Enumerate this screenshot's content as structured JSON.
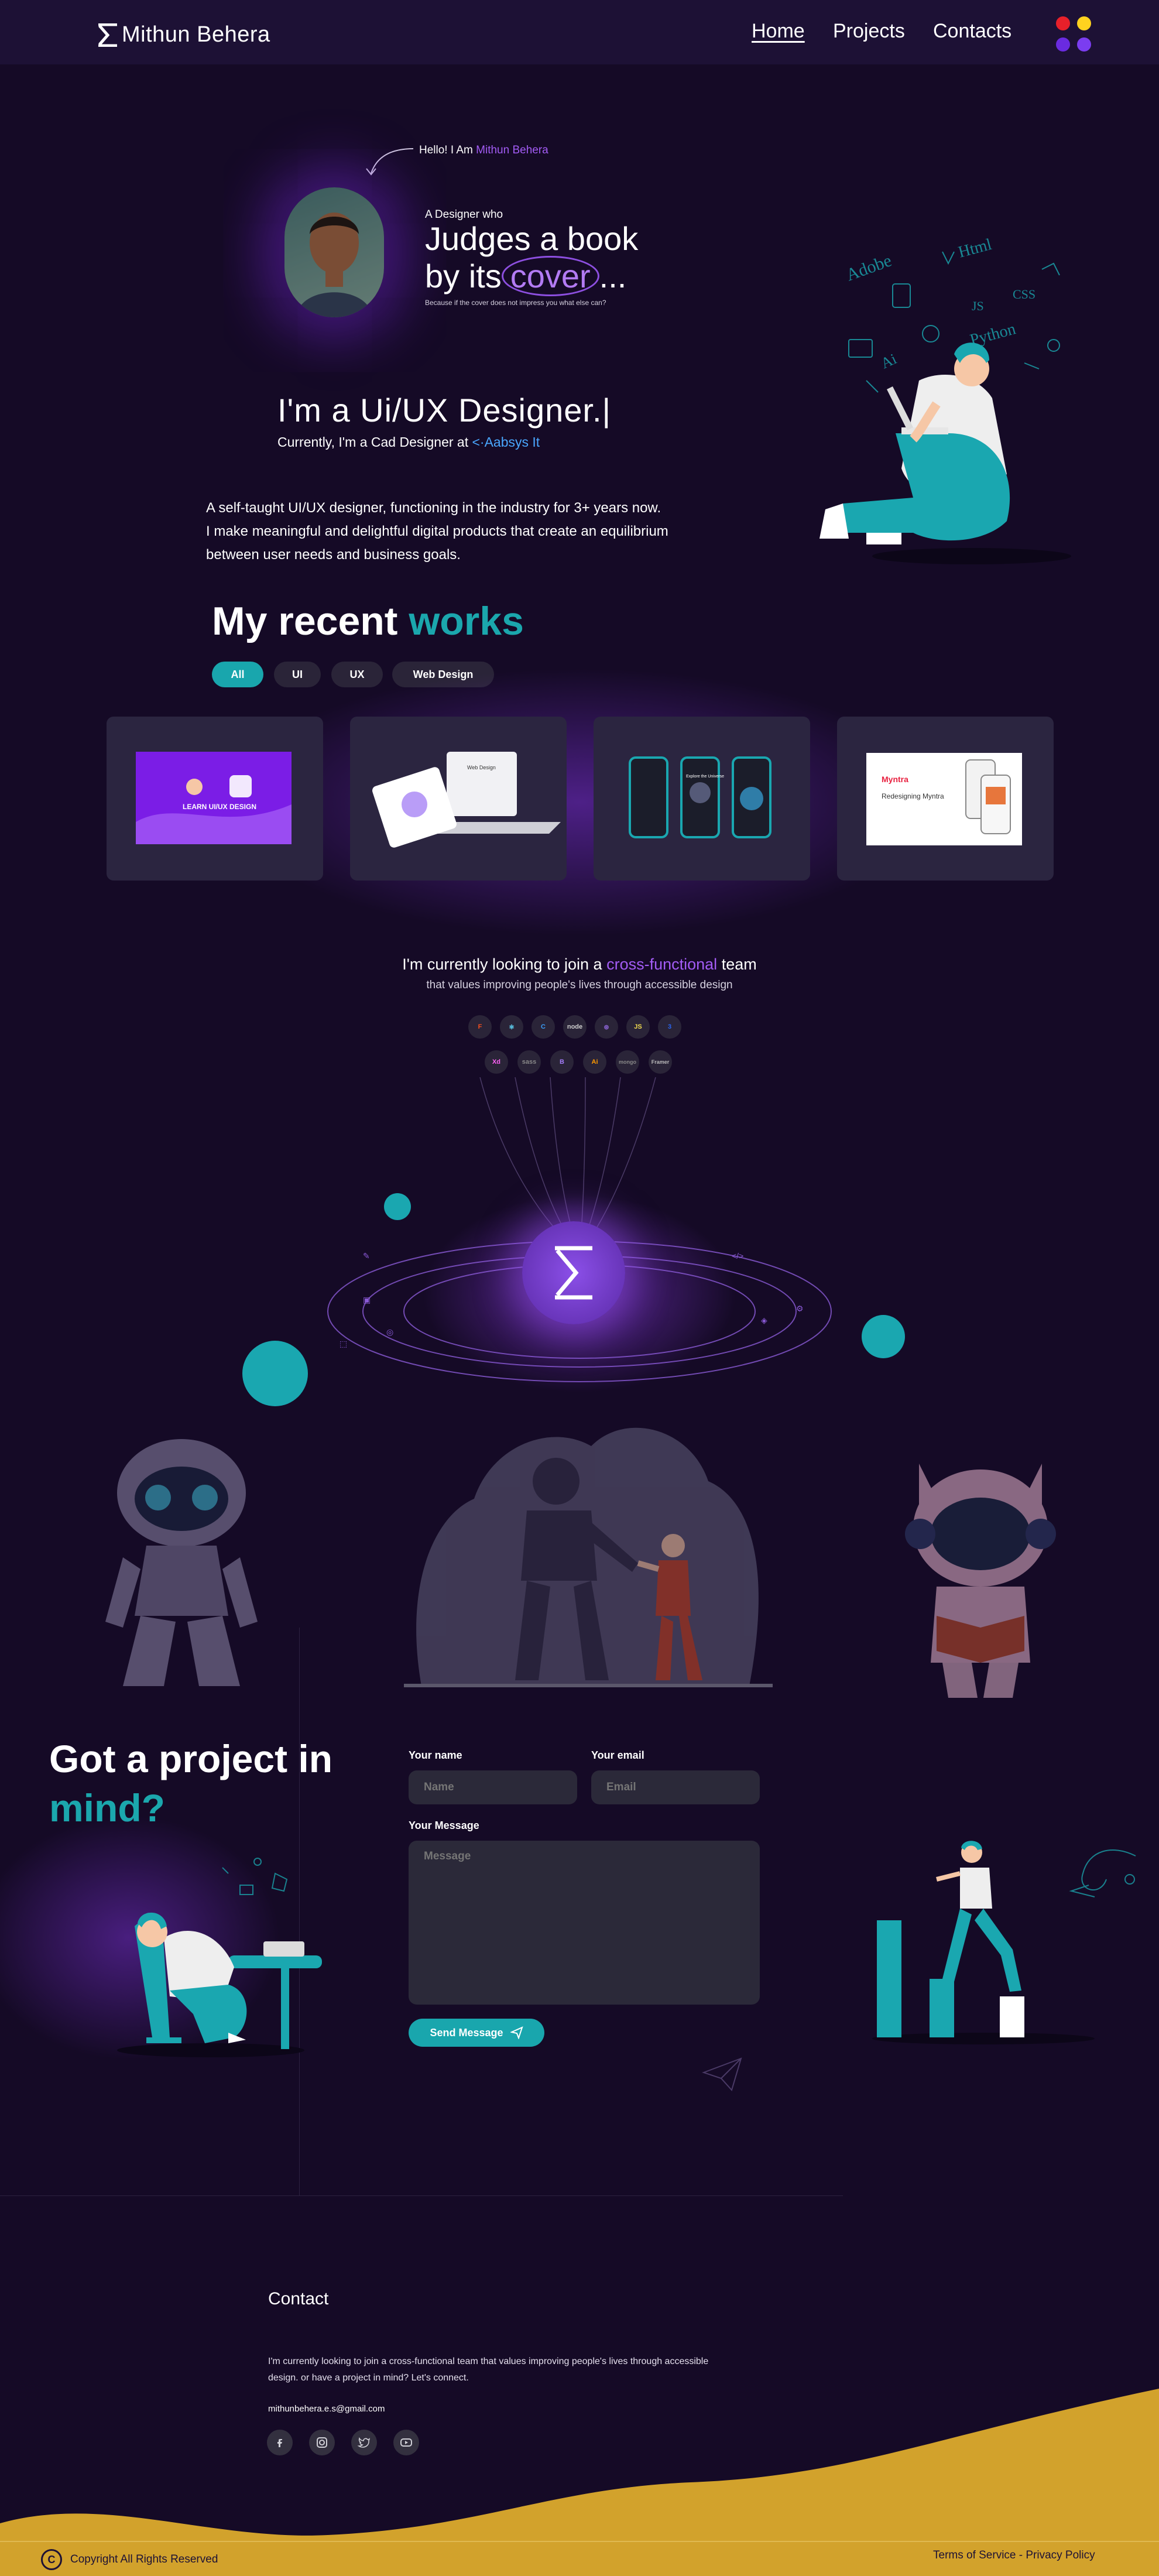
{
  "header": {
    "brand": "Mithun Behera",
    "nav": {
      "home": "Home",
      "projects": "Projects",
      "contacts": "Contacts"
    },
    "theme_colors": [
      "#e8202a",
      "#ffd21f",
      "#6a2be0",
      "#7b3df0"
    ]
  },
  "hero": {
    "greeting": "Hello! I Am",
    "name": "Mithun Behera",
    "designer_who": "A Designer who",
    "headline_line1": "Judges a book",
    "headline_line2_pre": "by its",
    "headline_cover": "cover",
    "headline_ellipsis": "...",
    "tagline": "Because if the cover does not impress you what else can?",
    "role": "I'm a Ui/UX Designer.|",
    "currently_prefix": "Currently, I'm a Cad Designer at",
    "company": "Aabsys It",
    "about_line1": "A self-taught UI/UX designer, functioning in the industry for 3+ years now.",
    "about_line2": "I make meaningful and delightful digital products that create an equilibrium",
    "about_line3": "between user needs and business goals."
  },
  "works": {
    "title_pre": "My recent",
    "title_accent": "works",
    "filters": [
      "All",
      "UI",
      "UX",
      "Web Design"
    ],
    "active_filter": "All",
    "cards": [
      {
        "name": "learn-ui-design",
        "text": "LEARN UI/UX DESIGN"
      },
      {
        "name": "web-design-laptop",
        "text": "Web Design"
      },
      {
        "name": "mobile-app",
        "text": "Explore the Universe"
      },
      {
        "name": "myntra-redesign",
        "text": "Myntra",
        "subtitle": "Redesigning Myntra"
      }
    ]
  },
  "team": {
    "line_pre": "I'm currently looking to join a",
    "line_accent": "cross-functional",
    "line_post": "team",
    "sub": "that values improving people's lives through accessible design",
    "tools_row1": [
      "figma-icon",
      "react-icon",
      "c-icon",
      "node-icon",
      "redux-icon",
      "js-icon",
      "css-icon"
    ],
    "tools_row2": [
      "xd-icon",
      "sass-icon",
      "bootstrap-icon",
      "illustrator-icon",
      "mongodb-icon",
      "framer-icon"
    ],
    "tool_labels_row2": [
      "Xd",
      "sass",
      "B",
      "Ai",
      "mongo",
      "Framer"
    ]
  },
  "project": {
    "title_line1": "Got a project in",
    "title_line2": "mind?",
    "name_label": "Your name",
    "name_placeholder": "Name",
    "email_label": "Your email",
    "email_placeholder": "Email",
    "message_label": "Your Message",
    "message_placeholder": "Message",
    "send_label": "Send Message"
  },
  "footer": {
    "contact_title": "Contact",
    "contact_text": "I'm currently looking to join a cross-functional team that values improving people's lives through accessible design. or have a project in mind? Let's connect.",
    "email": "mithunbehera.e.s@gmail.com",
    "socials": [
      "facebook-icon",
      "instagram-icon",
      "twitter-icon",
      "youtube-icon"
    ],
    "copyright": "Copyright All Rights Reserved",
    "legal": "Terms of Service - Privacy Policy",
    "wave_color": "#d2a22c"
  }
}
